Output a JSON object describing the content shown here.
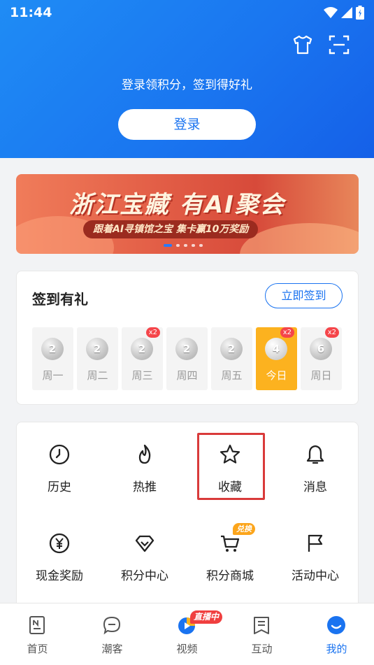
{
  "status_bar": {
    "time": "11:44"
  },
  "header": {
    "login_prompt": "登录领积分，签到得好礼",
    "login_button": "登录",
    "icons": [
      "tshirt-icon",
      "scan-icon"
    ]
  },
  "banner": {
    "title": "浙江宝藏 有AI聚会",
    "subtitle": "跟着AI寻镇馆之宝 集卡赢10万奖励",
    "pages": 5,
    "active_page": 1
  },
  "signin": {
    "title": "签到有礼",
    "button": "立即签到",
    "days": [
      {
        "label": "周一",
        "points": "2",
        "bonus": ""
      },
      {
        "label": "周二",
        "points": "2",
        "bonus": ""
      },
      {
        "label": "周三",
        "points": "2",
        "bonus": "x2"
      },
      {
        "label": "周四",
        "points": "2",
        "bonus": ""
      },
      {
        "label": "周五",
        "points": "2",
        "bonus": ""
      },
      {
        "label": "今日",
        "points": "4",
        "bonus": "x2"
      },
      {
        "label": "周日",
        "points": "6",
        "bonus": "x2"
      }
    ]
  },
  "features": [
    {
      "label": "历史",
      "icon": "clock-icon"
    },
    {
      "label": "热推",
      "icon": "flame-icon"
    },
    {
      "label": "收藏",
      "icon": "star-icon"
    },
    {
      "label": "消息",
      "icon": "bell-icon"
    },
    {
      "label": "现金奖励",
      "icon": "yuan-coin-icon"
    },
    {
      "label": "积分中心",
      "icon": "diamond-icon"
    },
    {
      "label": "积分商城",
      "icon": "cart-icon",
      "badge": "兑换"
    },
    {
      "label": "活动中心",
      "icon": "flag-icon"
    }
  ],
  "bottom_nav": [
    {
      "label": "首页",
      "icon": "news-icon"
    },
    {
      "label": "潮客",
      "icon": "chat-icon"
    },
    {
      "label": "视频",
      "icon": "video-icon",
      "badge": "直播中"
    },
    {
      "label": "互动",
      "icon": "interact-icon"
    },
    {
      "label": "我的",
      "icon": "profile-icon",
      "active": true
    }
  ],
  "colors": {
    "primary": "#1a73f0",
    "today": "#fcb21f",
    "badge_red": "#f5454a",
    "highlight": "#d93a3a"
  }
}
